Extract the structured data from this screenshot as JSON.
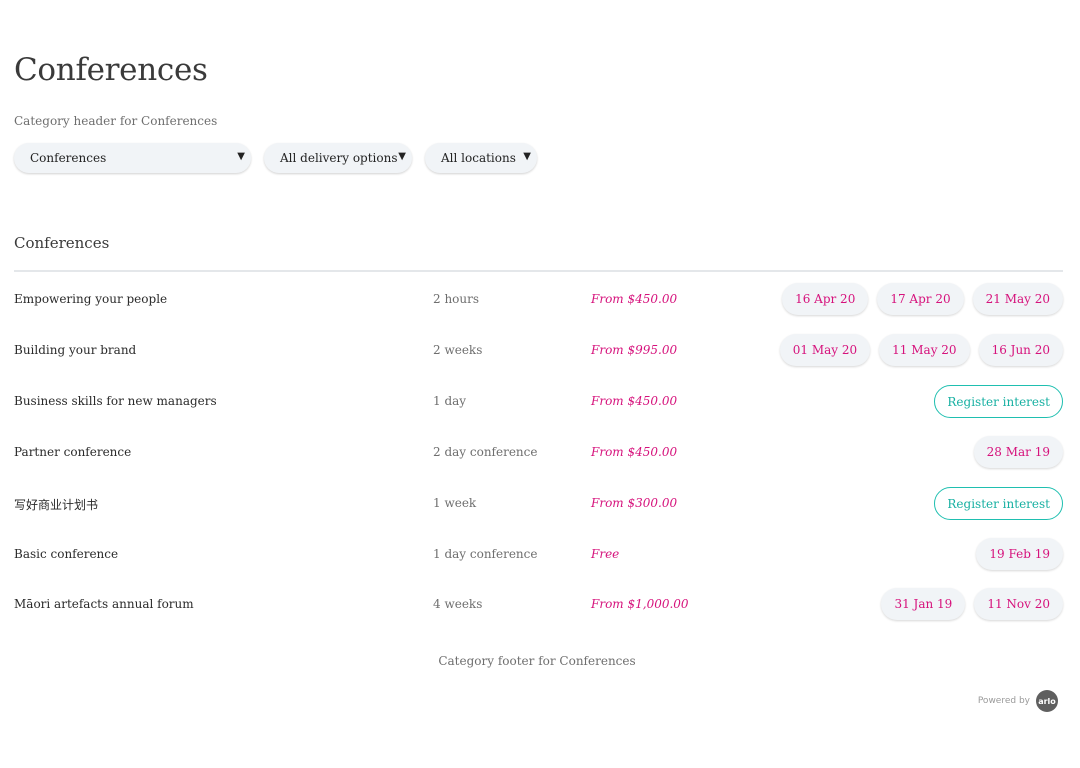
{
  "page_title": "Conferences",
  "category_header": "Category header for Conferences",
  "filters": {
    "category": "Conferences",
    "delivery": "All delivery options",
    "location": "All locations"
  },
  "section_title": "Conferences",
  "events": [
    {
      "name": "Empowering your people",
      "duration": "2 hours",
      "price": "From $450.00",
      "dates": [
        "16 Apr 20",
        "17 Apr 20",
        "21 May 20"
      ]
    },
    {
      "name": "Building your brand",
      "duration": "2 weeks",
      "price": "From $995.00",
      "dates": [
        "01 May 20",
        "11 May 20",
        "16 Jun 20"
      ]
    },
    {
      "name": "Business skills for new managers",
      "duration": "1 day",
      "price": "From $450.00",
      "register_label": "Register interest"
    },
    {
      "name": "Partner conference",
      "duration": "2 day conference",
      "price": "From $450.00",
      "dates": [
        "28 Mar 19"
      ]
    },
    {
      "name": "写好商业计划书",
      "duration": "1 week",
      "price": "From $300.00",
      "register_label": "Register interest"
    },
    {
      "name": "Basic conference",
      "duration": "1 day conference",
      "price": "Free",
      "dates": [
        "19 Feb 19"
      ]
    },
    {
      "name": "Māori artefacts annual forum",
      "duration": "4 weeks",
      "price": "From $1,000.00",
      "dates": [
        "31 Jan 19",
        "11 Nov 20"
      ]
    }
  ],
  "category_footer": "Category footer for Conferences",
  "powered_by": "Powered by",
  "logo_text": "arlo",
  "colors": {
    "price": "#d6127c",
    "date_text": "#d6127c",
    "register_accent": "#1fbfb0",
    "pill_background": "#f1f4f7"
  }
}
